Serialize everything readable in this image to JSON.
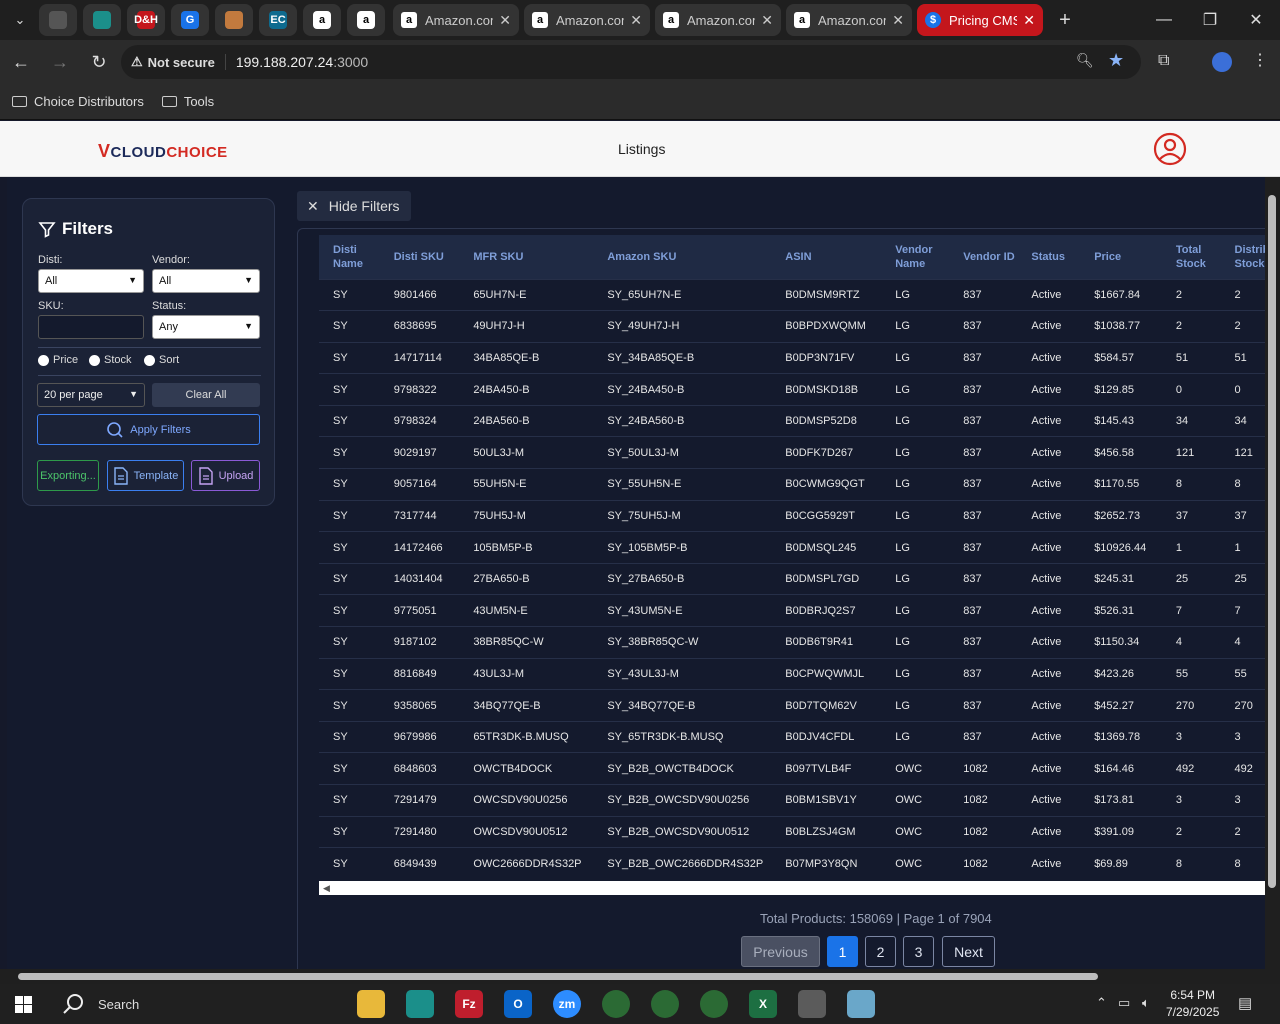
{
  "browser": {
    "pinned_tabs": [
      {
        "icon": "chrome-settings-icon",
        "color": "#555555"
      },
      {
        "icon": "teal-diamond-icon",
        "color": "#1b8f8a"
      },
      {
        "icon": "dh-icon",
        "glyph": "D&H",
        "color": "#c4161c"
      },
      {
        "icon": "g-icon",
        "glyph": "G",
        "color": "#1a73e8"
      },
      {
        "icon": "box-icon",
        "color": "#c27a3e"
      },
      {
        "icon": "ec-icon",
        "glyph": "EC",
        "color": "#0e6b8f"
      },
      {
        "icon": "amazon-icon",
        "glyph": "a",
        "color": "#ffffff"
      },
      {
        "icon": "amazon-icon",
        "glyph": "a",
        "color": "#ffffff"
      }
    ],
    "tabs": [
      {
        "title": "Amazon.com",
        "fav": "a"
      },
      {
        "title": "Amazon.com",
        "fav": "a"
      },
      {
        "title": "Amazon.com",
        "fav": "a"
      },
      {
        "title": "Amazon.com",
        "fav": "a"
      },
      {
        "title": "Pricing CMS",
        "fav": "$",
        "active": true
      }
    ],
    "security_label": "Not secure",
    "url_host": "199.188.207.24",
    "url_port": ":3000",
    "bookmarks": [
      "Choice Distributors",
      "Tools"
    ]
  },
  "app": {
    "logo_v": "V",
    "logo_cloud": "CLOUD",
    "logo_choice": "CHOICE",
    "nav_listings": "Listings"
  },
  "filters": {
    "title": "Filters",
    "disti_label": "Disti:",
    "disti_value": "All",
    "vendor_label": "Vendor:",
    "vendor_value": "All",
    "sku_label": "SKU:",
    "sku_value": "",
    "status_label": "Status:",
    "status_value": "Any",
    "radios": [
      "Price",
      "Stock",
      "Sort"
    ],
    "per_page": "20 per page",
    "clear_all": "Clear All",
    "apply": "Apply Filters",
    "exporting": "Exporting...",
    "template": "Template",
    "upload": "Upload",
    "hide_filters": "Hide Filters"
  },
  "table": {
    "headers": [
      "Disti Name",
      "Disti SKU",
      "MFR SKU",
      "Amazon SKU",
      "ASIN",
      "Vendor Name",
      "Vendor ID",
      "Status",
      "Price",
      "Total Stock",
      "Distributor Stock"
    ],
    "rows": [
      [
        "SY",
        "9801466",
        "65UH7N-E",
        "SY_65UH7N-E",
        "B0DMSM9RTZ",
        "LG",
        "837",
        "Active",
        "$1667.84",
        "2",
        "2"
      ],
      [
        "SY",
        "6838695",
        "49UH7J-H",
        "SY_49UH7J-H",
        "B0BPDXWQMM",
        "LG",
        "837",
        "Active",
        "$1038.77",
        "2",
        "2"
      ],
      [
        "SY",
        "14717114",
        "34BA85QE-B",
        "SY_34BA85QE-B",
        "B0DP3N71FV",
        "LG",
        "837",
        "Active",
        "$584.57",
        "51",
        "51"
      ],
      [
        "SY",
        "9798322",
        "24BA450-B",
        "SY_24BA450-B",
        "B0DMSKD18B",
        "LG",
        "837",
        "Active",
        "$129.85",
        "0",
        "0"
      ],
      [
        "SY",
        "9798324",
        "24BA560-B",
        "SY_24BA560-B",
        "B0DMSP52D8",
        "LG",
        "837",
        "Active",
        "$145.43",
        "34",
        "34"
      ],
      [
        "SY",
        "9029197",
        "50UL3J-M",
        "SY_50UL3J-M",
        "B0DFK7D267",
        "LG",
        "837",
        "Active",
        "$456.58",
        "121",
        "121"
      ],
      [
        "SY",
        "9057164",
        "55UH5N-E",
        "SY_55UH5N-E",
        "B0CWMG9QGT",
        "LG",
        "837",
        "Active",
        "$1170.55",
        "8",
        "8"
      ],
      [
        "SY",
        "7317744",
        "75UH5J-M",
        "SY_75UH5J-M",
        "B0CGG5929T",
        "LG",
        "837",
        "Active",
        "$2652.73",
        "37",
        "37"
      ],
      [
        "SY",
        "14172466",
        "105BM5P-B",
        "SY_105BM5P-B",
        "B0DMSQL245",
        "LG",
        "837",
        "Active",
        "$10926.44",
        "1",
        "1"
      ],
      [
        "SY",
        "14031404",
        "27BA650-B",
        "SY_27BA650-B",
        "B0DMSPL7GD",
        "LG",
        "837",
        "Active",
        "$245.31",
        "25",
        "25"
      ],
      [
        "SY",
        "9775051",
        "43UM5N-E",
        "SY_43UM5N-E",
        "B0DBRJQ2S7",
        "LG",
        "837",
        "Active",
        "$526.31",
        "7",
        "7"
      ],
      [
        "SY",
        "9187102",
        "38BR85QC-W",
        "SY_38BR85QC-W",
        "B0DB6T9R41",
        "LG",
        "837",
        "Active",
        "$1150.34",
        "4",
        "4"
      ],
      [
        "SY",
        "8816849",
        "43UL3J-M",
        "SY_43UL3J-M",
        "B0CPWQWMJL",
        "LG",
        "837",
        "Active",
        "$423.26",
        "55",
        "55"
      ],
      [
        "SY",
        "9358065",
        "34BQ77QE-B",
        "SY_34BQ77QE-B",
        "B0D7TQM62V",
        "LG",
        "837",
        "Active",
        "$452.27",
        "270",
        "270"
      ],
      [
        "SY",
        "9679986",
        "65TR3DK-B.MUSQ",
        "SY_65TR3DK-B.MUSQ",
        "B0DJV4CFDL",
        "LG",
        "837",
        "Active",
        "$1369.78",
        "3",
        "3"
      ],
      [
        "SY",
        "6848603",
        "OWCTB4DOCK",
        "SY_B2B_OWCTB4DOCK",
        "B097TVLB4F",
        "OWC",
        "1082",
        "Active",
        "$164.46",
        "492",
        "492"
      ],
      [
        "SY",
        "7291479",
        "OWCSDV90U0256",
        "SY_B2B_OWCSDV90U0256",
        "B0BM1SBV1Y",
        "OWC",
        "1082",
        "Active",
        "$173.81",
        "3",
        "3"
      ],
      [
        "SY",
        "7291480",
        "OWCSDV90U0512",
        "SY_B2B_OWCSDV90U0512",
        "B0BLZSJ4GM",
        "OWC",
        "1082",
        "Active",
        "$391.09",
        "2",
        "2"
      ],
      [
        "SY",
        "6849439",
        "OWC2666DDR4S32P",
        "SY_B2B_OWC2666DDR4S32P",
        "B07MP3Y8QN",
        "OWC",
        "1082",
        "Active",
        "$69.89",
        "8",
        "8"
      ]
    ]
  },
  "pager": {
    "totals": "Total Products: 158069 | Page 1 of 7904",
    "previous": "Previous",
    "pages": [
      "1",
      "2",
      "3"
    ],
    "next": "Next"
  },
  "taskbar": {
    "search": "Search",
    "time": "6:54 PM",
    "date": "7/29/2025"
  },
  "colors": {
    "accent": "#1a73e8",
    "header_text": "#7f9ed8",
    "page_bg": "#141a2d",
    "active_tab": "#c4161c"
  }
}
